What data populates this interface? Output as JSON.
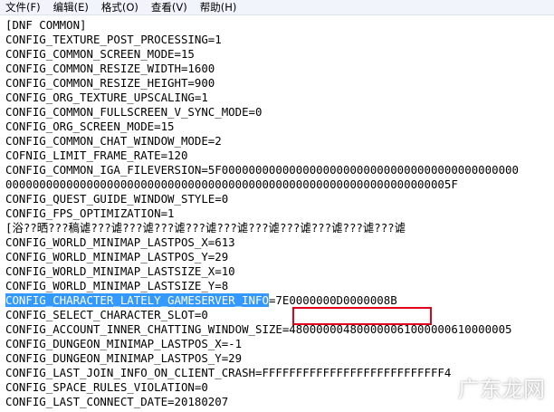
{
  "menubar": {
    "items": [
      "文件(F)",
      "编辑(E)",
      "格式(O)",
      "查看(V)",
      "帮助(H)"
    ]
  },
  "editor": {
    "lines": [
      "[DNF COMMON]",
      "CONFIG_TEXTURE_POST_PROCESSING=1",
      "CONFIG_COMMON_SCREEN_MODE=15",
      "CONFIG_COMMON_RESIZE_WIDTH=1600",
      "CONFIG_COMMON_RESIZE_HEIGHT=900",
      "CONFIG_ORG_TEXTURE_UPSCALING=1",
      "CONFIG_COMMON_FULLSCREEN_V_SYNC_MODE=0",
      "CONFIG_ORG_SCREEN_MODE=15",
      "CONFIG_COMMON_CHAT_WINDOW_MODE=2",
      "COFNIG_LIMIT_FRAME_RATE=120",
      "CONFIG_COMMON_IGA_FILEVERSION=5F00000000000000000000000000000000000000000000",
      "000000000000000000000000000000000000000000000000000000000000000005F",
      "CONFIG_QUEST_GUIDE_WINDOW_STYLE=0",
      "CONFIG_FPS_OPTIMIZATION=1",
      "[浴??晒???稿谑???谑???谑???谑???谑???谑???谑???谑???谑???谑???谑",
      "CONFIG_WORLD_MINIMAP_LASTPOS_X=613",
      "CONFIG_WORLD_MINIMAP_LASTPOS_Y=29",
      "CONFIG_WORLD_MINIMAP_LASTSIZE_X=10",
      "CONFIG_WORLD_MINIMAP_LASTSIZE_Y=8"
    ],
    "selected_line": {
      "key": "CONFIG_CHARACTER_LATELY_GAMESERVER_INFO",
      "value": "=7E0000000D0000008B"
    },
    "lines_after": [
      "CONFIG_SELECT_CHARACTER_SLOT=0",
      "CONFIG_ACCOUNT_INNER_CHATTING_WINDOW_SIZE=480000004800000061000000610000005",
      "CONFIG_DUNGEON_MINIMAP_LASTPOS_X=-1",
      "CONFIG_DUNGEON_MINIMAP_LASTPOS_Y=29",
      "CONFIG_LAST_JOIN_INFO_ON_CLIENT_CRASH=FFFFFFFFFFFFFFFFFFFFFFFFFFF4",
      "CONFIG_SPACE_RULES_VIOLATION=0",
      "CONFIG_LAST_CONNECT_DATE=20180207"
    ]
  },
  "watermark": {
    "text": "广东龙网"
  },
  "colors": {
    "selection": "#3399ff",
    "highlight_box": "#e4001b"
  }
}
